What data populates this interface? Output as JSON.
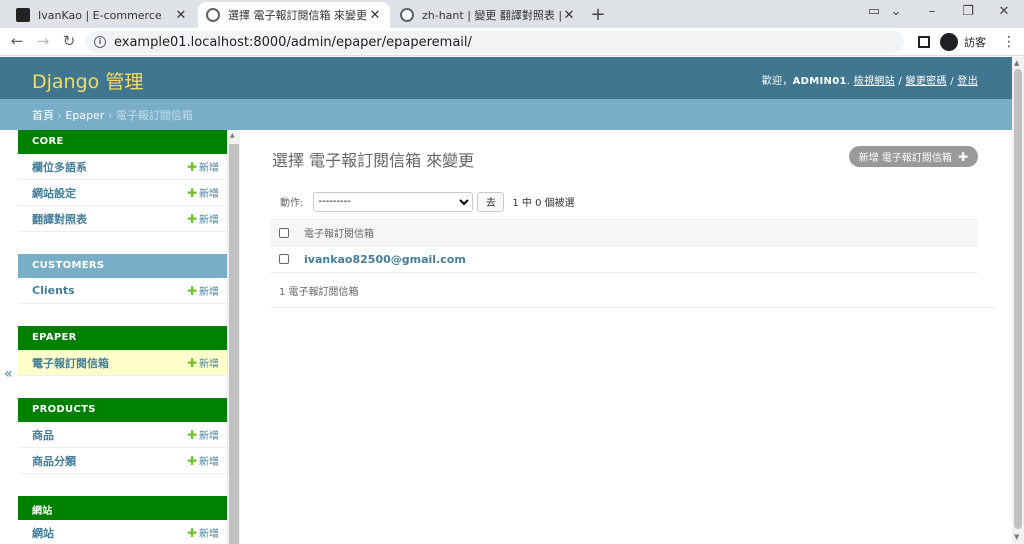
{
  "browser": {
    "tabs": [
      {
        "title": "IvanKao | E-commerce",
        "active": false,
        "icon": "django-icon"
      },
      {
        "title": "選擇 電子報訂閱信箱 來變更 | Dj",
        "active": true,
        "icon": "globe-icon"
      },
      {
        "title": "zh-hant | 變更 翻譯對照表 | Djan",
        "active": false,
        "icon": "globe-icon"
      }
    ],
    "close_glyph": "✕",
    "new_tab_glyph": "+",
    "url": "example01.localhost:8000/admin/epaper/epaperemail/",
    "profile_label": "訪客",
    "window_controls": [
      "⌄",
      "–",
      "❐",
      "✕"
    ]
  },
  "header": {
    "branding": "Django 管理",
    "welcome": "歡迎，",
    "username": "ADMIN01",
    "view_site": "檢視網站",
    "change_password": "變更密碼",
    "logout": "登出",
    "separator": " / "
  },
  "breadcrumbs": {
    "home": "首頁",
    "app": "Epaper",
    "current": "電子報訂閱信箱",
    "sep": " › "
  },
  "sidebar": {
    "collapse_glyph": "«",
    "add_label": "新增",
    "modules": [
      {
        "caption": "CORE",
        "color": "green",
        "items": [
          {
            "name": "欄位多語系",
            "selected": false
          },
          {
            "name": "網站設定",
            "selected": false
          },
          {
            "name": "翻譯對照表",
            "selected": false
          }
        ]
      },
      {
        "caption": "CUSTOMERS",
        "color": "blue",
        "items": [
          {
            "name": "Clients",
            "selected": false
          }
        ]
      },
      {
        "caption": "EPAPER",
        "color": "green",
        "items": [
          {
            "name": "電子報訂閱信箱",
            "selected": true
          }
        ]
      },
      {
        "caption": "PRODUCTS",
        "color": "green",
        "items": [
          {
            "name": "商品",
            "selected": false
          },
          {
            "name": "商品分類",
            "selected": false
          }
        ]
      },
      {
        "caption": "網站",
        "color": "green",
        "items": [
          {
            "name": "網站",
            "selected": false
          }
        ]
      }
    ]
  },
  "content": {
    "title": "選擇 電子報訂閱信箱 來變更",
    "add_button": "新增 電子報訂閱信箱",
    "actions_label": "動作:",
    "action_selected": "---------",
    "go_button": "去",
    "selection_counter": "1 中 0 個被選",
    "column_header": "電子報訂閱信箱",
    "rows": [
      {
        "email": "ivankao82500@gmail.com"
      }
    ],
    "result_count": "1 電子報訂閱信箱"
  },
  "colors": {
    "header_bg": "#417690",
    "branding": "#f5dd5d",
    "breadcrumbs_bg": "#79aec8",
    "module_green": "#008000",
    "module_blue": "#79aec8",
    "link": "#447e9b",
    "selected_row": "#ffffcc"
  }
}
